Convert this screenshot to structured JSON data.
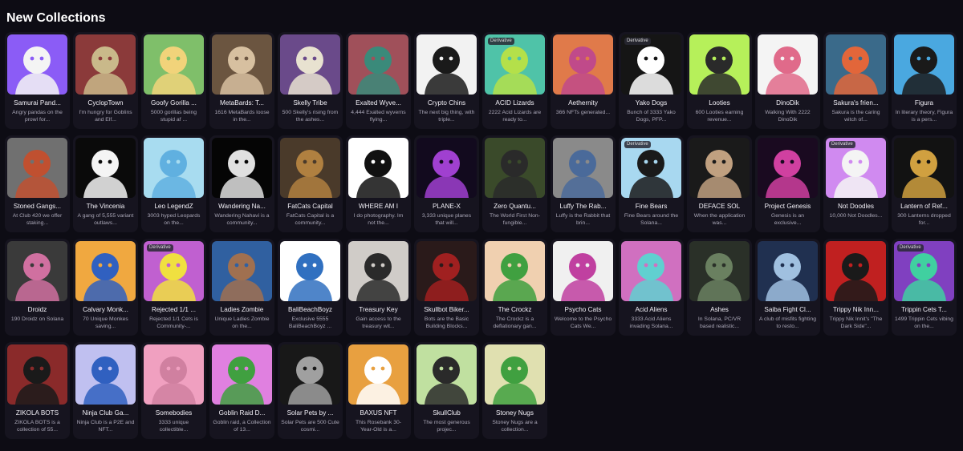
{
  "page": {
    "title": "New Collections"
  },
  "collections": [
    {
      "name": "Samurai Pand...",
      "desc": "Angry pandas on the prowl for...",
      "color": "#8b5cf6",
      "accent": "#f4f4f4",
      "badge": ""
    },
    {
      "name": "CyclopTown",
      "desc": "I'm hungry for Goblins and Elf...",
      "color": "#8b3a3a",
      "accent": "#c9b98a",
      "badge": ""
    },
    {
      "name": "Goofy Gorilla ...",
      "desc": "5000 gorillas being stupid af ...",
      "color": "#7fbf6a",
      "accent": "#f1d37a",
      "badge": ""
    },
    {
      "name": "MetaBards: T...",
      "desc": "1616 MetaBards loose in the...",
      "color": "#6b5540",
      "accent": "#d7c0a0",
      "badge": ""
    },
    {
      "name": "Skelly Tribe",
      "desc": "500 Skelly's rising from the ashes...",
      "color": "#6a4a8a",
      "accent": "#e8e2d0",
      "badge": ""
    },
    {
      "name": "Exalted Wyve...",
      "desc": "4,444 Exalted wyverns flying...",
      "color": "#a0505a",
      "accent": "#3a8a7a",
      "badge": ""
    },
    {
      "name": "Crypto Chins",
      "desc": "The next big thing, with triple...",
      "color": "#f2f2f2",
      "accent": "#1a1a1a",
      "badge": ""
    },
    {
      "name": "ACID Lizards",
      "desc": "2222 Acid Lizards are ready to...",
      "color": "#4fc3a8",
      "accent": "#b4e04a",
      "badge": "Derivative"
    },
    {
      "name": "Aethernity",
      "desc": "366 NFTs generated...",
      "color": "#e07a4a",
      "accent": "#c04a8a",
      "badge": ""
    },
    {
      "name": "Yako Dogs",
      "desc": "Bunch of 3333 Yako Dogs, PFP...",
      "color": "#151515",
      "accent": "#ffffff",
      "badge": "Derivative"
    },
    {
      "name": "Looties",
      "desc": "600 Looties earning revenue...",
      "color": "#b6f05a",
      "accent": "#2a2a2a",
      "badge": ""
    },
    {
      "name": "DinoDik",
      "desc": "Walking With 2222 DinoDik",
      "color": "#f4f4f4",
      "accent": "#e06a8a",
      "badge": ""
    },
    {
      "name": "Sakura's frien...",
      "desc": "Sakura is the caring witch of...",
      "color": "#3a6a8a",
      "accent": "#e2663a",
      "badge": ""
    },
    {
      "name": "Figura",
      "desc": "In literary theory, Figura is a pers...",
      "color": "#4aa8e0",
      "accent": "#1a1a1a",
      "badge": ""
    },
    {
      "name": "Stoned Gangs...",
      "desc": "At Club 420 we offer staking...",
      "color": "#707070",
      "accent": "#c05030",
      "badge": ""
    },
    {
      "name": "The Vincenia",
      "desc": "A gang of 5,555 variant outlaws...",
      "color": "#0a0a0a",
      "accent": "#f4f4f4",
      "badge": ""
    },
    {
      "name": "Leo LegendZ",
      "desc": "3003 hyped Leopards on the...",
      "color": "#a8dcf0",
      "accent": "#60b0e0",
      "badge": ""
    },
    {
      "name": "Wandering Na...",
      "desc": "Wandering Nahavi is a community...",
      "color": "#050505",
      "accent": "#e0e0e0",
      "badge": ""
    },
    {
      "name": "FatCats Capital",
      "desc": "FatCats Capital is a community...",
      "color": "#4a3a2a",
      "accent": "#b08040",
      "badge": ""
    },
    {
      "name": "WHERE AM I",
      "desc": "I do photography. Im not the...",
      "color": "#ffffff",
      "accent": "#111111",
      "badge": ""
    },
    {
      "name": "PLANE-X",
      "desc": "3,333 unique planes that will...",
      "color": "#120a1e",
      "accent": "#a040d0",
      "badge": ""
    },
    {
      "name": "Zero Quantu...",
      "desc": "The World First Non-fungible...",
      "color": "#3a4a2a",
      "accent": "#2a2a2a",
      "badge": ""
    },
    {
      "name": "Luffy The Rab...",
      "desc": "Luffy is the Rabbit that brin...",
      "color": "#8a8a8a",
      "accent": "#4a6a9a",
      "badge": ""
    },
    {
      "name": "Fine Bears",
      "desc": "Fine Bears around the Solana...",
      "color": "#a8d8f0",
      "accent": "#1a1a1a",
      "badge": "Derivative"
    },
    {
      "name": "DEFACE SOL",
      "desc": "When the application was...",
      "color": "#1a1a1a",
      "accent": "#c0a080",
      "badge": ""
    },
    {
      "name": "Project Genesis",
      "desc": "Genesis is an exclusive...",
      "color": "#1a0a20",
      "accent": "#d040a0",
      "badge": ""
    },
    {
      "name": "Not Doodles",
      "desc": "10,000 Not Doodles...",
      "color": "#d08af0",
      "accent": "#f4f4f4",
      "badge": "Derivative"
    },
    {
      "name": "Lantern of Ref...",
      "desc": "300 Lanterns dropped for...",
      "color": "#121212",
      "accent": "#d0a040",
      "badge": ""
    },
    {
      "name": "Droidz",
      "desc": "190 Droidz on Solana",
      "color": "#3a3a3a",
      "accent": "#d070a0",
      "badge": ""
    },
    {
      "name": "Calvary Monk...",
      "desc": "70 Unique Monkes saving...",
      "color": "#f0a840",
      "accent": "#3060c0",
      "badge": ""
    },
    {
      "name": "Rejected 1/1 ...",
      "desc": "Rejected 1/1 Cets is Community-...",
      "color": "#c060d0",
      "accent": "#f0e040",
      "badge": "Derivative"
    },
    {
      "name": "Ladies Zombie",
      "desc": "Unique Ladies Zombie on the...",
      "color": "#3060a0",
      "accent": "#a07050",
      "badge": ""
    },
    {
      "name": "BaliBeachBoyz",
      "desc": "Exclusive 5555 BaliBeachBoyz ...",
      "color": "#ffffff",
      "accent": "#3070c0",
      "badge": ""
    },
    {
      "name": "Treasury Key",
      "desc": "Gain access to the treasury wit...",
      "color": "#d0ccc8",
      "accent": "#2a2a2a",
      "badge": ""
    },
    {
      "name": "Skullbot Biker...",
      "desc": "Bots are the Basic Building Blocks...",
      "color": "#2a1a1a",
      "accent": "#a02020",
      "badge": ""
    },
    {
      "name": "The Crockz",
      "desc": "The Crockz is a deflationary gan...",
      "color": "#f0d0b0",
      "accent": "#40a040",
      "badge": ""
    },
    {
      "name": "Psycho Cats",
      "desc": "Welcome to the Psycho Cats We...",
      "color": "#f0f0f0",
      "accent": "#c040a0",
      "badge": ""
    },
    {
      "name": "Acid Aliens",
      "desc": "3333 Acid Aliens invading Solana...",
      "color": "#d070c0",
      "accent": "#60d0d0",
      "badge": ""
    },
    {
      "name": "Ashes",
      "desc": "In Solana, PC/VR based realistic...",
      "color": "#2a3028",
      "accent": "#6a8060",
      "badge": ""
    },
    {
      "name": "Saiba Fight Cl...",
      "desc": "A club of misfits fighting to resto...",
      "color": "#203050",
      "accent": "#a0c0e0",
      "badge": ""
    },
    {
      "name": "Trippy Nik Inn...",
      "desc": "Trippy Nik Innit's \"The Dark Side\"...",
      "color": "#c02020",
      "accent": "#1a1a1a",
      "badge": ""
    },
    {
      "name": "Trippin Cets T...",
      "desc": "1499 Trippin Cets vibing on the...",
      "color": "#8040c0",
      "accent": "#40d0a0",
      "badge": "Derivative"
    },
    {
      "name": "ZIKOLA BOTS",
      "desc": "ZIKOLA BOTS is a collection of 55...",
      "color": "#8a2a2a",
      "accent": "#1a1a1a",
      "badge": ""
    },
    {
      "name": "Ninja Club Ga...",
      "desc": "Ninja Club is a P2E and NFT...",
      "color": "#c0c0f0",
      "accent": "#3060c0",
      "badge": ""
    },
    {
      "name": "Somebodies",
      "desc": "3333 unique collectible...",
      "color": "#f0a0c0",
      "accent": "#d080a0",
      "badge": ""
    },
    {
      "name": "Goblin Raid D...",
      "desc": "Goblin raid, a Collection of 13...",
      "color": "#e080e0",
      "accent": "#40a040",
      "badge": ""
    },
    {
      "name": "Solar Pets by ...",
      "desc": "Solar Pets are 500 Cute cosmi...",
      "color": "#181818",
      "accent": "#a0a0a0",
      "badge": ""
    },
    {
      "name": "BAXUS NFT",
      "desc": "This Rosebank 30-Year-Old is a...",
      "color": "#e8a040",
      "accent": "#ffffff",
      "badge": ""
    },
    {
      "name": "SkullClub",
      "desc": "The most generous projec...",
      "color": "#c0e0a0",
      "accent": "#2a2a2a",
      "badge": ""
    },
    {
      "name": "Stoney Nugs",
      "desc": "Stoney Nugs are a collection...",
      "color": "#e0e0b0",
      "accent": "#40a040",
      "badge": ""
    }
  ]
}
